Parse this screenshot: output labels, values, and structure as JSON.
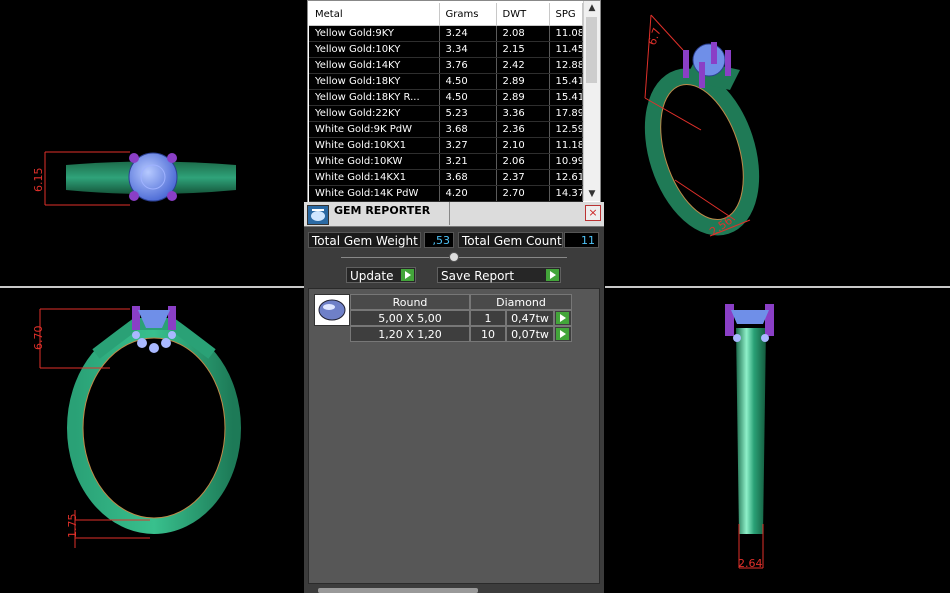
{
  "views": {
    "top_left": {
      "dimension": "6.15"
    },
    "top_right": {
      "dimension_top": "6.7",
      "dimension_bottom": "2.56"
    },
    "bottom_left": {
      "dimension_top": "6.70",
      "dimension_bottom": "1.75"
    },
    "bottom_right": {
      "dimension_bottom": "2.64"
    }
  },
  "metal_table": {
    "headers": [
      "Metal",
      "Grams",
      "DWT",
      "SPG"
    ],
    "rows": [
      [
        "Yellow Gold:9KY",
        "3.24",
        "2.08",
        "11.08"
      ],
      [
        "Yellow Gold:10KY",
        "3.34",
        "2.15",
        "11.45"
      ],
      [
        "Yellow Gold:14KY",
        "3.76",
        "2.42",
        "12.88"
      ],
      [
        "Yellow Gold:18KY",
        "4.50",
        "2.89",
        "15.41"
      ],
      [
        "Yellow Gold:18KY R...",
        "4.50",
        "2.89",
        "15.41"
      ],
      [
        "Yellow Gold:22KY",
        "5.23",
        "3.36",
        "17.89"
      ],
      [
        "White Gold:9K PdW",
        "3.68",
        "2.36",
        "12.59"
      ],
      [
        "White Gold:10KX1",
        "3.27",
        "2.10",
        "11.18"
      ],
      [
        "White Gold:10KW",
        "3.21",
        "2.06",
        "10.99"
      ],
      [
        "White Gold:14KX1",
        "3.68",
        "2.37",
        "12.61"
      ],
      [
        "White Gold:14K PdW",
        "4.20",
        "2.70",
        "14.37"
      ]
    ]
  },
  "gem_reporter": {
    "title": "GEM REPORTER",
    "close_glyph": "×",
    "total_weight_label": "Total Gem Weight",
    "total_weight_value": ",53",
    "total_count_label": "Total Gem Count",
    "total_count_value": "11",
    "update_label": "Update",
    "save_report_label": "Save Report",
    "gem_shape": "Round",
    "gem_type": "Diamond",
    "gems": [
      {
        "size": "5,00 X 5,00",
        "count": "1",
        "weight": "0,47tw"
      },
      {
        "size": "1,20 X 1,20",
        "count": "10",
        "weight": "0,07tw"
      }
    ]
  },
  "colors": {
    "ring_metal": "#2e9e73",
    "gem_stone": "#6f8fe8",
    "prong": "#8a3fc6",
    "dimension_line": "#e0302a",
    "play_button": "#43a53a",
    "value_text": "#4fc3f7"
  },
  "icons": {
    "gem_reporter_logo": "gem-reporter-logo-icon",
    "row_action": "play-icon",
    "scroll_up": "chevron-up-icon",
    "scroll_down": "chevron-down-icon",
    "close": "close-icon",
    "gem_thumbnail": "round-gem-icon"
  }
}
